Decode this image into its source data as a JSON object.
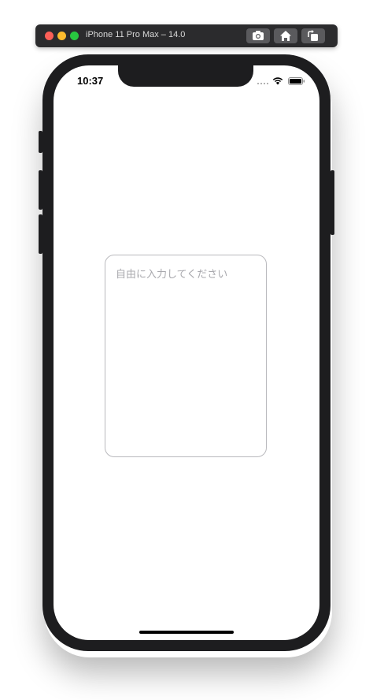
{
  "simulator": {
    "title": "iPhone 11 Pro Max – 14.0",
    "buttons": [
      {
        "icon": "camera-icon"
      },
      {
        "icon": "home-icon"
      },
      {
        "icon": "rotate-icon"
      }
    ]
  },
  "status_bar": {
    "time": "10:37",
    "wifi_icon": "wifi-icon",
    "battery_icon": "battery-icon"
  },
  "text_view": {
    "placeholder": "自由に入力してください",
    "value": ""
  },
  "colors": {
    "phone_frame": "#1d1d1f",
    "title_bar": "#2b2b2d",
    "text_view_border": "#b9b9bd",
    "placeholder": "#a8a8ad"
  }
}
